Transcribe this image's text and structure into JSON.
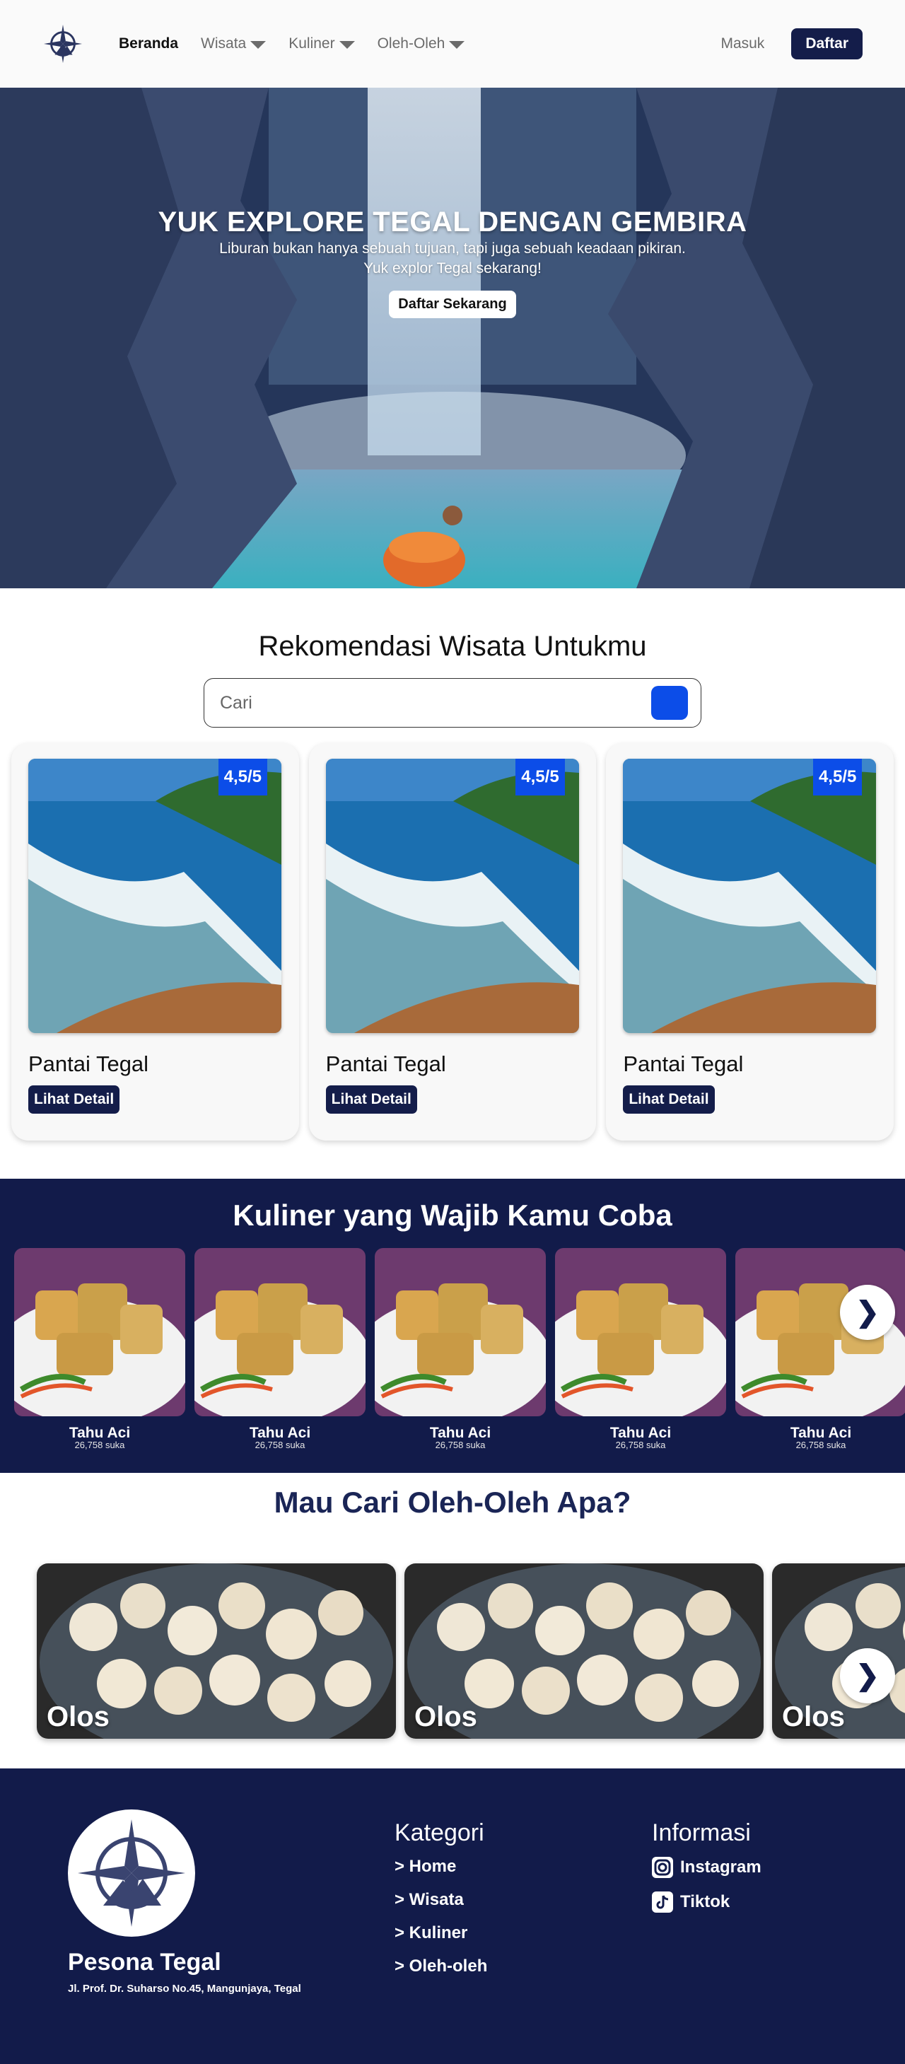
{
  "nav": {
    "items": [
      {
        "label": "Beranda"
      },
      {
        "label": "Wisata"
      },
      {
        "label": "Kuliner"
      },
      {
        "label": "Oleh-Oleh"
      }
    ],
    "login_label": "Masuk",
    "signup_label": "Daftar"
  },
  "hero": {
    "title": "YUK EXPLORE TEGAL DENGAN GEMBIRA",
    "subtitle_line1": "Liburan bukan hanya sebuah tujuan, tapi juga sebuah keadaan pikiran.",
    "subtitle_line2": "Yuk explor Tegal sekarang!",
    "cta_label": "Daftar Sekarang"
  },
  "recommendation": {
    "title": "Rekomendasi Wisata Untukmu",
    "search_placeholder": "Cari",
    "cards": [
      {
        "name": "Pantai Tegal",
        "rating": "4,5/5",
        "button": "Lihat Detail"
      },
      {
        "name": "Pantai Tegal",
        "rating": "4,5/5",
        "button": "Lihat Detail"
      },
      {
        "name": "Pantai Tegal",
        "rating": "4,5/5",
        "button": "Lihat Detail"
      }
    ]
  },
  "kuliner": {
    "title": "Kuliner yang Wajib Kamu Coba",
    "items": [
      {
        "name": "Tahu Aci",
        "likes": "26,758 suka"
      },
      {
        "name": "Tahu Aci",
        "likes": "26,758 suka"
      },
      {
        "name": "Tahu Aci",
        "likes": "26,758 suka"
      },
      {
        "name": "Tahu Aci",
        "likes": "26,758 suka"
      },
      {
        "name": "Tahu Aci",
        "likes": "26,758 suka"
      }
    ],
    "next_icon": "chevron-right-icon"
  },
  "oleh": {
    "title": "Mau Cari Oleh-Oleh Apa?",
    "items": [
      {
        "name": "Olos"
      },
      {
        "name": "Olos"
      },
      {
        "name": "Olos"
      }
    ]
  },
  "footer": {
    "brand": "Pesona Tegal",
    "address": "Jl. Prof. Dr. Suharso No.45, Mangunjaya, Tegal",
    "kategori_title": "Kategori",
    "kategori_links": [
      "> Home",
      "> Wisata",
      "> Kuliner",
      "> Oleh-oleh"
    ],
    "informasi_title": "Informasi",
    "informasi_links": [
      {
        "label": "Instagram",
        "icon": "instagram-icon"
      },
      {
        "label": "Tiktok",
        "icon": "tiktok-icon"
      }
    ]
  },
  "colors": {
    "navy": "#121b4a",
    "accent_blue": "#0c4de8",
    "nav_bg": "#fafafa"
  }
}
